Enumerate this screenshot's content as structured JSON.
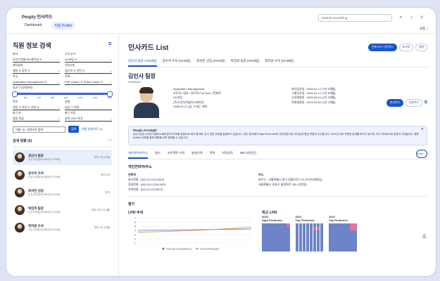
{
  "app": {
    "brand": "Peopty 인사카드",
    "nav": [
      "Dashboard",
      "직원 Profile"
    ],
    "search_placeholder": "Search everything",
    "settings": "설정 ⌄"
  },
  "filters": {
    "title": "직원 정보 검색",
    "fields": [
      {
        "label": "회사:",
        "value": "두산디지털이노베이션 ✕"
      },
      {
        "label": "소속 부서:",
        "value": "HCM팀 ✕"
      },
      {
        "label": "재직상태:",
        "value": "재직 ✕  휴직 ✕"
      },
      {
        "label": "사원유형:",
        "value": "정규직 ✕  인턴 ✕"
      },
      {
        "label": "직무:",
        "value": "Application Management ✕"
      },
      {
        "label": "직책:",
        "value": "Part Leader ✕  Team Leader ✕"
      }
    ],
    "lpm_label": "성과 구간(백분위):",
    "ticks": [
      "0",
      "200",
      "400",
      "600",
      "800",
      "1000",
      "1200",
      "1400"
    ],
    "fields2": [
      {
        "label": "직위:",
        "value": "차장 ✕  차장 ✕  부장 ✕"
      },
      {
        "label": "성별:",
        "value": "남성  ☐  여성"
      },
      {
        "label": "최근 과:",
        "value": "질렁 직급"
      },
      {
        "label": "최근 기준:",
        "value": "성적 20% 이내"
      }
    ],
    "search_placeholder": "이름, ID, 사번으로 검색",
    "search_btn": "검색",
    "reset_link": "최종 업데이트 (1)"
  },
  "results": {
    "header": "검색 현황 (6)",
    "people": [
      {
        "name": "김인사 팀장",
        "dept": "두산디지털이노베이션 HCM팀",
        "tenure": "재직 7년 8개월"
      },
      {
        "name": "강수지 수석",
        "dept": "두산디지털이노베이션 HCM팀",
        "tenure": "재직 8년"
      },
      {
        "name": "최서진 선임",
        "dept": "두산디지털이노베이션 HCM팀",
        "tenure": "휴직"
      },
      {
        "name": "박진희 팀장",
        "dept": "두산디지털이노베이션 HCM팀",
        "tenure": "재직 10년 11개월"
      },
      {
        "name": "최지윤 수석",
        "dept": "두산디지털이노베이션 HCM팀",
        "tenure": "재직 4년 3개월"
      }
    ]
  },
  "main": {
    "title": "인사카드 List",
    "buttons": [
      "전체 PDF 다운로드",
      "초기화",
      "설정"
    ],
    "tabs": [
      "김인사 팀장 (HCM팀)",
      "강수지 수석 (HCM팀)",
      "최서진 선임 (HCM팀)",
      "박진희 팀장 (HCM팀)",
      "최지윤 수석 (HCM팀)"
    ],
    "employee": {
      "name": "김인사 팀장",
      "id": "10000452",
      "actions": [
        "비교하기",
        "저장하기"
      ],
      "info": [
        "Application Management",
        "사무직 / 팀장 / 정규직 Full Time / 면제직",
        "HCM팀",
        "(주)두산디지털이노베이션",
        "1986.03.27 (남, 37세) / 재직"
      ],
      "details": [
        "회사입사일 : 2016-01-17 (7년 8개월)",
        "그룹입사일 : 2016-01-17 (7년 8개월)",
        "소속발령일 : 2003-06-01 (1년 3개월)",
        "직위발령일 : 2019-03-02 (4년 4개월)"
      ]
    },
    "insight": {
      "title": "Peoply AI Insight",
      "text": "김인사님은 두산디지털이노베이션의 HCM팀 팀장으로 재직 중이며, 인사 관련 업무를 총괄하고 있습니다. 최근 평가에서 High Performer로 선정되었으며, 리더십과 협업 역량이 우수합니다. 2022년 이후 꾸준한 성과를 보이고 있으며, 차기 리더로서의 성장이 기대됩니다. 향후 Softest 교육을 통해 역량을 더욱 강화할 수 있습니다."
    },
    "subtabs": [
      "개인연락처/주소",
      "평가",
      "프로젝트 이력",
      "발령이력",
      "학력",
      "어학성적",
      "360 다면진단"
    ],
    "more": "More ⌄",
    "contact": {
      "title": "개인연락처/주소",
      "col1": "연락처",
      "col2": "주소",
      "phones": [
        "회사전화 : (82) 02-1234-5678",
        "휴대전화 : (82) 010-1234-5678",
        "자택전화 : (82) 02-123-5678"
      ],
      "addresses": [
        "현주소 : 서울특별시 중구 장충단로 275 (두산타워빌딩)",
        "서울특별시 송파구 올림픽로 300 (신천동)"
      ]
    },
    "evaluation": {
      "title": "평가",
      "lpm_title": "LPM 추세",
      "legend": [
        "Overall Competency",
        "Overall Results"
      ],
      "heat_title": "최근 LPM",
      "years": [
        {
          "year": "2020",
          "label": "High Performer"
        },
        {
          "year": "2021",
          "label": "Top Performer"
        },
        {
          "year": "2022",
          "label": "Top Performer"
        }
      ]
    }
  },
  "chart_data": {
    "type": "line",
    "title": "LPM 추세",
    "x": [
      1,
      2,
      3,
      4,
      5
    ],
    "series": [
      {
        "name": "Overall Competency",
        "values": [
          3.5,
          3.6,
          3.7,
          3.8,
          3.9
        ]
      },
      {
        "name": "Overall Results",
        "values": [
          3.0,
          3.2,
          3.5,
          3.9,
          4.4
        ]
      }
    ],
    "ylim": [
      0,
      7
    ],
    "yticks": [
      "7",
      "6",
      "5",
      "4",
      "3",
      "2",
      "1"
    ],
    "colors": [
      "#4a74d9",
      "#f08a3c"
    ]
  }
}
